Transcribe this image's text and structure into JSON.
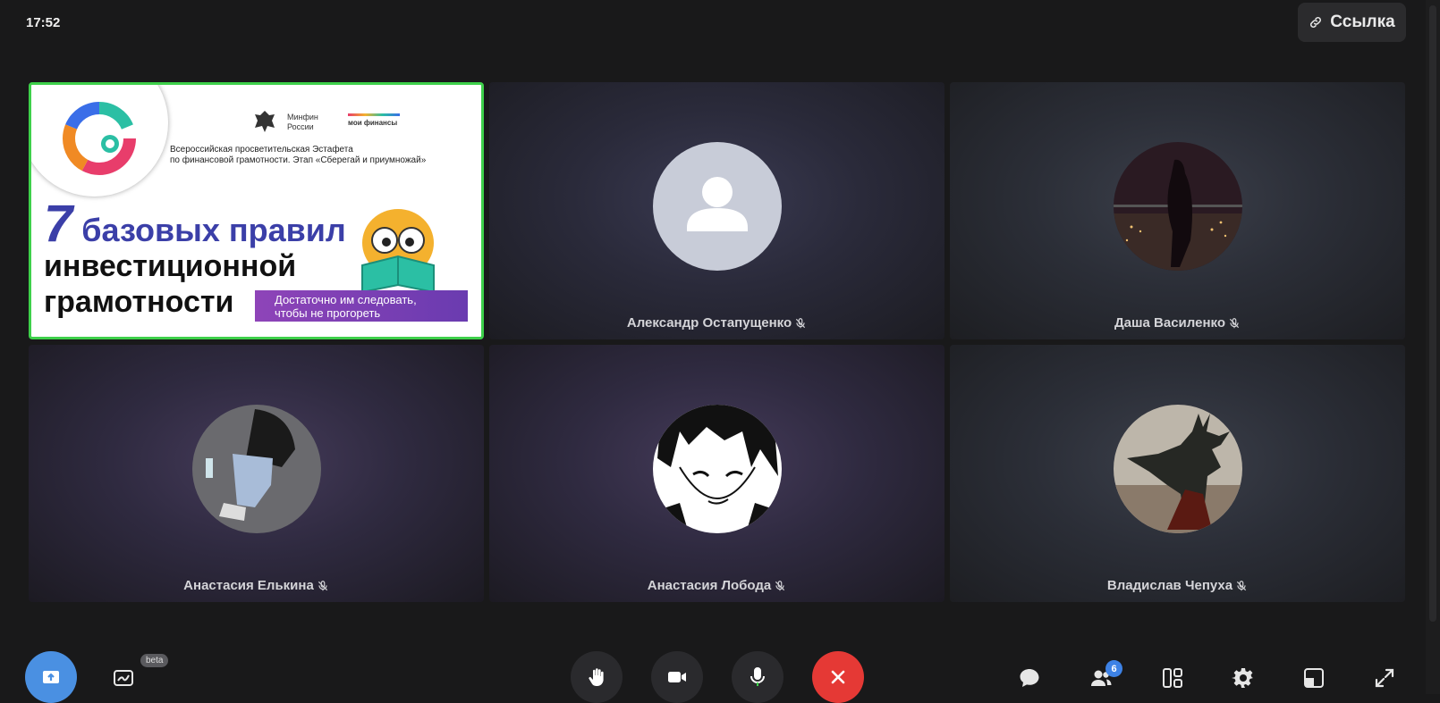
{
  "clock": "17:52",
  "header": {
    "link_label": "Ссылка"
  },
  "presentation": {
    "logo_text": "Эстафета Мои финансы",
    "ministry": "Минфин\nРоссии",
    "moi_finansy": "мои финансы",
    "subtitle_line1": "Всероссийская просветительская Эстафета",
    "subtitle_line2": "по финансовой грамотности. Этап «Сберегай и приумножай»",
    "headline_number": "7",
    "headline_line1": "базовых правил",
    "headline_line2": "инвестиционной",
    "headline_line3": "грамотности",
    "band_line1": "Достаточно им следовать,",
    "band_line2": "чтобы не прогореть"
  },
  "participants": [
    {
      "name": "Александр Остапущенко",
      "avatar": "default-avatar",
      "muted": true
    },
    {
      "name": "Даша Василенко",
      "avatar": "photo-avatar",
      "muted": true
    },
    {
      "name": "Анастасия Елькина",
      "avatar": "photo-avatar",
      "muted": true
    },
    {
      "name": "Анастасия Лобода",
      "avatar": "photo-avatar",
      "muted": true
    },
    {
      "name": "Владислав Чепуха",
      "avatar": "photo-avatar",
      "muted": true
    }
  ],
  "toolbar": {
    "beta_label": "beta",
    "participants_count": "6",
    "colors": {
      "share": "#4a90e2",
      "end_call": "#e53935",
      "mic_accent": "#3ed04a"
    }
  }
}
